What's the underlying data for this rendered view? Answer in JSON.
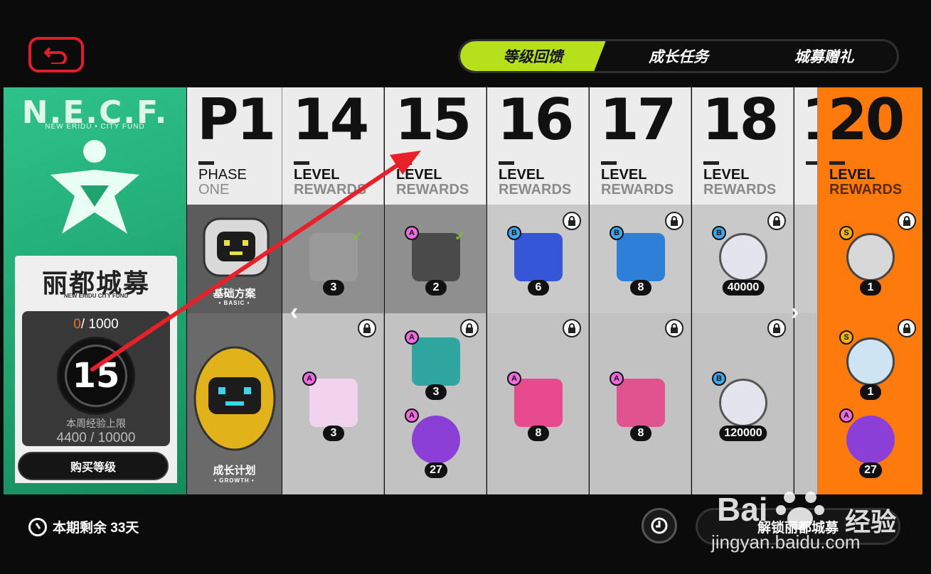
{
  "header": {
    "tabs": [
      {
        "label": "等级回馈",
        "active": true
      },
      {
        "label": "成长任务",
        "active": false
      },
      {
        "label": "城募赠礼",
        "active": false
      }
    ],
    "accent_color": "#b6df1c"
  },
  "fund": {
    "logo_text": "N.E.C.F.",
    "logo_sub": "NEW ERIDU • CITY FUND",
    "card_title": "丽都城募",
    "card_sub": "NEW ERIDU CITY FUND",
    "exp_current": "0",
    "exp_total": "/ 1000",
    "level": "15",
    "weekly_label": "本周经验上限",
    "weekly_value": "4400 / 10000",
    "buy_label": "购买等级"
  },
  "plans": {
    "basic_label": "基础方案",
    "basic_sub": "• BASIC •",
    "growth_label": "成长计划",
    "growth_sub": "• GROWTH •"
  },
  "columns": [
    {
      "num": "P1",
      "line1": "PHASE",
      "line2": "ONE"
    },
    {
      "num": "14",
      "line1": "LEVEL",
      "line2": "REWARDS",
      "basic": {
        "rank": "",
        "qty": "3",
        "claimed": true
      },
      "growth": [
        {
          "rank": "A",
          "qty": "3"
        }
      ]
    },
    {
      "num": "15",
      "line1": "LEVEL",
      "line2": "REWARDS",
      "basic": {
        "rank": "A",
        "qty": "2",
        "claimed": true
      },
      "growth": [
        {
          "rank": "A",
          "qty": "3"
        },
        {
          "rank": "A",
          "qty": "27"
        }
      ]
    },
    {
      "num": "16",
      "line1": "LEVEL",
      "line2": "REWARDS",
      "basic": {
        "rank": "B",
        "qty": "6"
      },
      "growth": [
        {
          "rank": "A",
          "qty": "8"
        }
      ]
    },
    {
      "num": "17",
      "line1": "LEVEL",
      "line2": "REWARDS",
      "basic": {
        "rank": "B",
        "qty": "8"
      },
      "growth": [
        {
          "rank": "A",
          "qty": "8"
        }
      ]
    },
    {
      "num": "18",
      "line1": "LEVEL",
      "line2": "REWARDS",
      "basic": {
        "rank": "B",
        "qty": "40000"
      },
      "growth": [
        {
          "rank": "B",
          "qty": "120000"
        }
      ]
    },
    {
      "num": "20",
      "line1": "LEVEL",
      "line2": "REWARDS",
      "basic": {
        "rank": "S",
        "qty": "1"
      },
      "growth": [
        {
          "rank": "S",
          "qty": "1"
        },
        {
          "rank": "A",
          "qty": "27"
        }
      ]
    }
  ],
  "footer": {
    "remaining": "本期剩余 33天",
    "unlock_label": "解锁丽都城募"
  },
  "watermark": {
    "logo": "Bai",
    "text": "经验",
    "url": "jingyan.baidu.com"
  },
  "colors": {
    "necf_green": "#1fa470",
    "orange": "#ff7a0c",
    "exp_orange": "#f36b1c",
    "back_red": "#e21d2b",
    "rank_a": "#f06ae0",
    "rank_b": "#3aa8f2",
    "rank_s": "#f1b400"
  }
}
